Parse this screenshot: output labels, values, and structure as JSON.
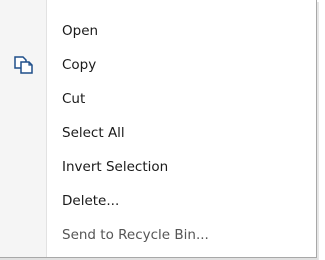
{
  "menu": {
    "items": [
      {
        "label": "Open",
        "icon": ""
      },
      {
        "label": "Copy",
        "icon": "copy-icon"
      },
      {
        "label": "Cut",
        "icon": ""
      },
      {
        "label": "Select All",
        "icon": ""
      },
      {
        "label": "Invert Selection",
        "icon": ""
      },
      {
        "label": "Delete...",
        "icon": ""
      },
      {
        "label": "Send to Recycle Bin...",
        "icon": ""
      }
    ]
  },
  "colors": {
    "icon_stroke": "#1f4f8a",
    "gutter": "#f5f5f5",
    "border": "#a8a8a8"
  }
}
